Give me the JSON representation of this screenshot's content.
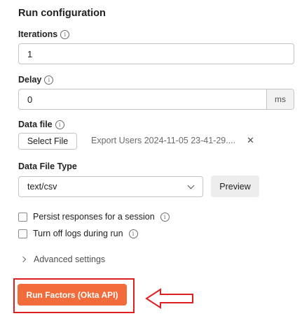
{
  "title": "Run configuration",
  "iterations": {
    "label": "Iterations",
    "value": "1"
  },
  "delay": {
    "label": "Delay",
    "value": "0",
    "unit": "ms"
  },
  "data_file": {
    "label": "Data file",
    "select_button": "Select File",
    "file_name": "Export Users 2024-11-05 23-41-29....",
    "remove_glyph": "✕"
  },
  "data_file_type": {
    "label": "Data File Type",
    "selected": "text/csv",
    "preview_button": "Preview"
  },
  "options": [
    {
      "label": "Persist responses for a session",
      "checked": false
    },
    {
      "label": "Turn off logs during run",
      "checked": false
    }
  ],
  "advanced": {
    "label": "Advanced settings"
  },
  "run_button": {
    "label": "Run Factors (Okta API)"
  },
  "colors": {
    "accent": "#f26b3a",
    "highlight": "#e02020"
  },
  "icons": {
    "info": "info-icon",
    "chevron_down": "chevron-down-icon",
    "chevron_right": "chevron-right-icon",
    "close": "close-icon",
    "arrow": "left-arrow-annotation-icon"
  }
}
